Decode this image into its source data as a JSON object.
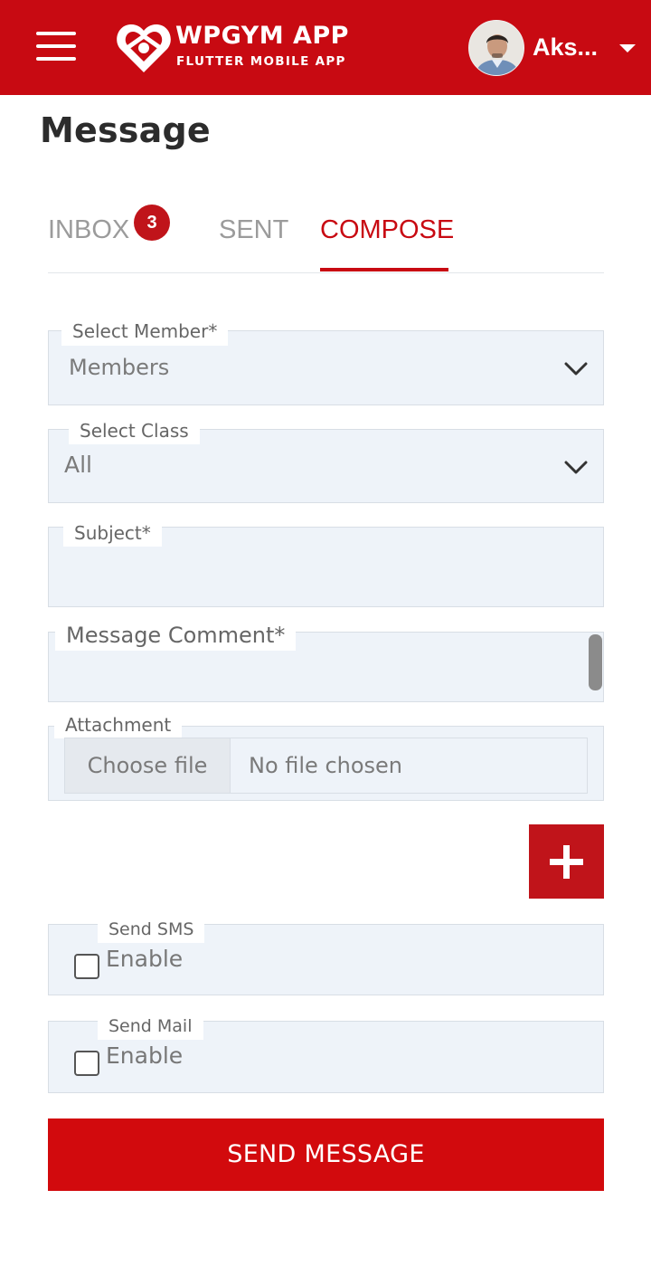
{
  "header": {
    "app_title": "WPGYM APP",
    "app_subtitle": "FLUTTER MOBILE APP",
    "user_name": "Aks...",
    "menu_icon": "hamburger-menu-icon",
    "dropdown_icon": "caret-down-icon",
    "brand_color": "#c80a12"
  },
  "page": {
    "title": "Message"
  },
  "tabs": [
    {
      "label": "INBOX",
      "badge": "3",
      "active": false
    },
    {
      "label": "SENT",
      "active": false
    },
    {
      "label": "COMPOSE",
      "active": true
    }
  ],
  "form": {
    "member": {
      "label": "Select Member*",
      "value": "Members"
    },
    "class": {
      "label": "Select Class",
      "value": "All"
    },
    "subject": {
      "label": "Subject*",
      "value": ""
    },
    "message": {
      "label": "Message Comment*",
      "value": ""
    },
    "attachment": {
      "label": "Attachment",
      "button_label": "Choose file",
      "status": "No file chosen"
    },
    "add_icon": "plus-icon",
    "send_sms": {
      "label": "Send SMS",
      "option_label": "Enable",
      "checked": false
    },
    "send_mail": {
      "label": "Send Mail",
      "option_label": "Enable",
      "checked": false
    },
    "submit_label": "SEND MESSAGE"
  }
}
